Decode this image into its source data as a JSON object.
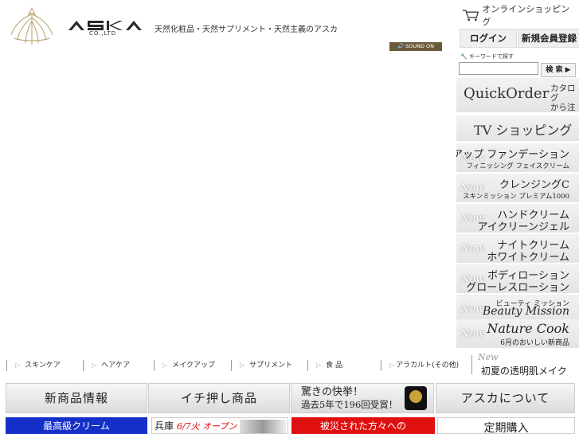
{
  "header": {
    "brand": "ASKA",
    "brand_sub": "CO.,LTD",
    "tagline": "天然化粧品・天然サプリメント・天然主義のアスカ",
    "sound_button": "🔊 SOUND ON"
  },
  "account": {
    "shop_link": "オンラインショッピング",
    "login": "ログイン",
    "register": "新規会員登録"
  },
  "search": {
    "label": "キーワードで探す",
    "value": "",
    "button": "検 索 ▶"
  },
  "quick_order": {
    "title": "QuickOrder",
    "sub1": "カタログ",
    "sub2": "から注文"
  },
  "tv_shopping": "TV ショッピング",
  "new_tag": "New",
  "products": [
    {
      "line1": "UV ナノアップ ファンデーション",
      "line2": "フィニッシング フェイスクリーム"
    },
    {
      "line1": "クレンジングC",
      "line2": "スキンミッション プレミアム1000"
    },
    {
      "line1": "ハンドクリーム",
      "line2": "アイクリーンジェル"
    },
    {
      "line1": "ナイトクリーム",
      "line2": "ホワイトクリーム"
    },
    {
      "line1": "ボディローション",
      "line2": "グローレスローション"
    },
    {
      "line1": "ビューティ ミッション",
      "line2": "Beauty Mission"
    },
    {
      "line1": "Nature Cook",
      "line2": "6月のおいしい新商品"
    }
  ],
  "categories": [
    "スキンケア",
    "ヘアケア",
    "メイクアップ",
    "サプリメント",
    "食 品",
    "アラカルト(その他)"
  ],
  "summer": {
    "new": "New",
    "text": "初夏の透明肌メイク"
  },
  "banners": {
    "new_products": "新商品情報",
    "recommended": "イチ押し商品",
    "award_line1": "驚きの快挙！",
    "award_line2": "過去5年で196回受賞！",
    "about": "アスカについて"
  },
  "row3": {
    "cream": "最高級クリーム",
    "hyogo_a": "兵庫",
    "hyogo_b": "6/7火 オープン",
    "disaster": "被災された方々への",
    "regular": "定期購入"
  }
}
